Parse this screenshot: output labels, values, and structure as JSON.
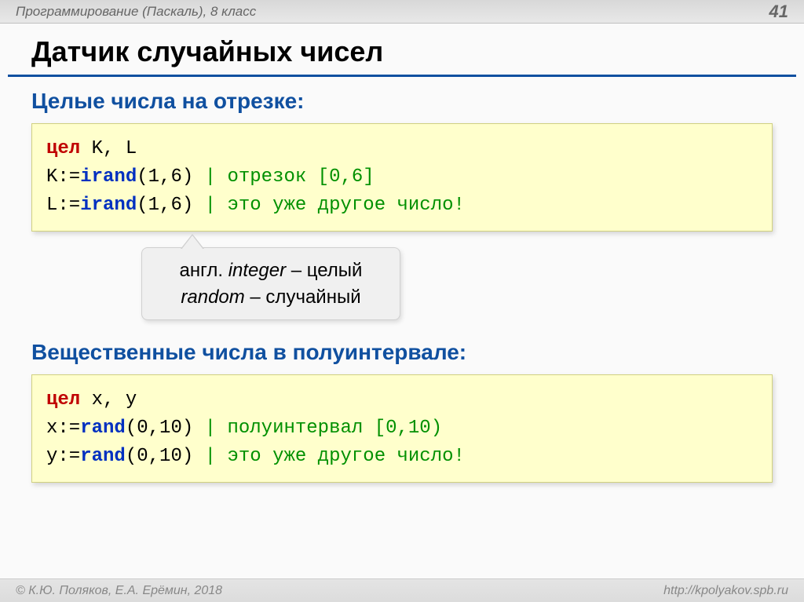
{
  "header": {
    "breadcrumb": "Программирование (Паскаль), 8 класс",
    "page_number": "41"
  },
  "title": "Датчик случайных чисел",
  "section1": {
    "title": "Целые числа на отрезке:",
    "code": {
      "line1": {
        "kw": "цел",
        "vars": " K, L"
      },
      "line2": {
        "assign": "K:=",
        "fn": "irand",
        "args": "(1,6)",
        "comment": " | отрезок [0,6]"
      },
      "line3": {
        "assign": "L:=",
        "fn": "irand",
        "args": "(1,6)",
        "comment": " | это уже другое число!"
      }
    }
  },
  "callout": {
    "line1_pre": "англ. ",
    "line1_em": "integer",
    "line1_post": " – целый",
    "line2_em": "random",
    "line2_post": " – случайный"
  },
  "section2": {
    "title": "Вещественные числа в полуинтервале:",
    "code": {
      "line1": {
        "kw": "цел",
        "vars": " x, y"
      },
      "line2": {
        "assign": "x:=",
        "fn": "rand",
        "args": "(0,10)",
        "comment": " | полуинтервал [0,10)"
      },
      "line3": {
        "assign": "y:=",
        "fn": "rand",
        "args": "(0,10)",
        "comment": " | это уже другое число!"
      }
    }
  },
  "footer": {
    "copyright": "© К.Ю. Поляков, Е.А. Ерёмин, 2018",
    "url": "http://kpolyakov.spb.ru"
  }
}
